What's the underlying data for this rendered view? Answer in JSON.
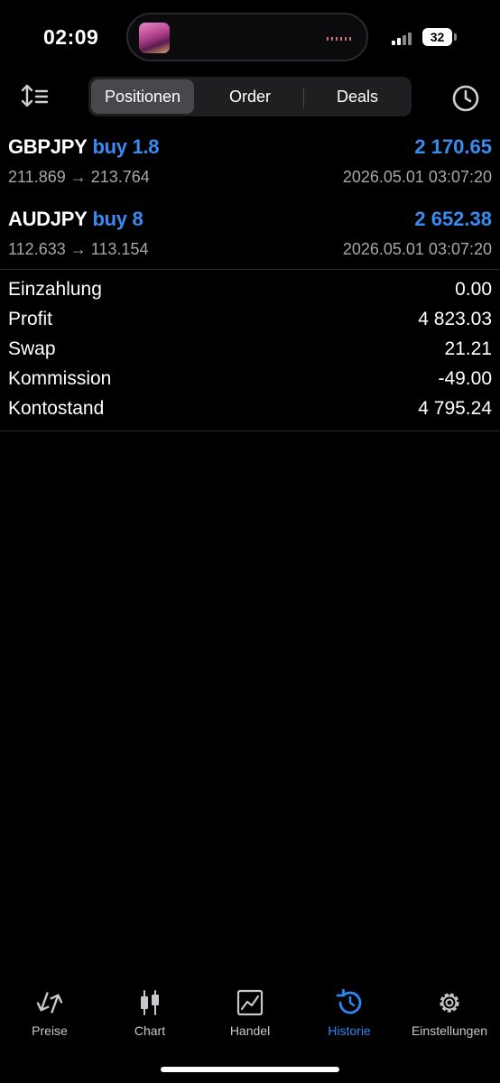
{
  "status_bar": {
    "time": "02:09",
    "battery": "32"
  },
  "toolbar": {
    "tabs": [
      {
        "label": "Positionen",
        "active": true
      },
      {
        "label": "Order",
        "active": false
      },
      {
        "label": "Deals",
        "active": false
      }
    ]
  },
  "positions": [
    {
      "symbol": "GBPJPY",
      "side": "buy 1.8",
      "profit": "2 170.65",
      "prices": "211.869 → 213.764",
      "time": "2026.05.01 03:07:20"
    },
    {
      "symbol": "AUDJPY",
      "side": "buy 8",
      "profit": "2 652.38",
      "prices": "112.633 → 113.154",
      "time": "2026.05.01 03:07:20"
    }
  ],
  "summary": [
    {
      "label": "Einzahlung",
      "value": "0.00"
    },
    {
      "label": "Profit",
      "value": "4 823.03"
    },
    {
      "label": "Swap",
      "value": "21.21"
    },
    {
      "label": "Kommission",
      "value": "-49.00"
    },
    {
      "label": "Kontostand",
      "value": "4 795.24"
    }
  ],
  "tabbar": {
    "items": [
      {
        "label": "Preise",
        "icon": "arrows-up-down-icon"
      },
      {
        "label": "Chart",
        "icon": "candlestick-icon"
      },
      {
        "label": "Handel",
        "icon": "trade-chart-icon"
      },
      {
        "label": "Historie",
        "icon": "history-icon",
        "active": true
      },
      {
        "label": "Einstellungen",
        "icon": "gear-icon"
      }
    ]
  },
  "colors": {
    "accent": "#3a8bf0",
    "background": "#000000",
    "muted": "#a7a7ab"
  }
}
